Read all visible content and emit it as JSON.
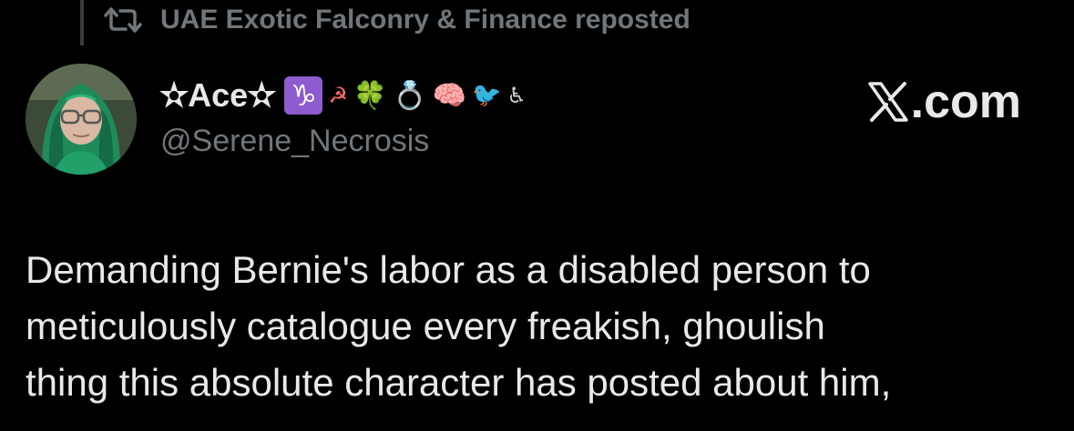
{
  "repost": {
    "label": "UAE Exotic Falconry & Finance reposted",
    "icon": "repost-icon"
  },
  "author": {
    "display_name": "✫Ace✫",
    "emojis": [
      "♑",
      "☭",
      "🍀",
      "💍",
      "🧠",
      "🐦",
      "♿"
    ],
    "handle": "@Serene_Necrosis",
    "avatar": "avatar-photo"
  },
  "watermark": {
    "text": ".com",
    "logo": "x-logo-icon"
  },
  "tweet": {
    "text": "Demanding Bernie's labor as a disabled person to\nmeticulously catalogue every freakish, ghoulish\nthing this absolute character has posted about him,"
  },
  "colors": {
    "background": "#000000",
    "text_primary": "#e7e9ea",
    "text_secondary": "#71767b",
    "capricorn_badge": "#8e5bd0"
  }
}
